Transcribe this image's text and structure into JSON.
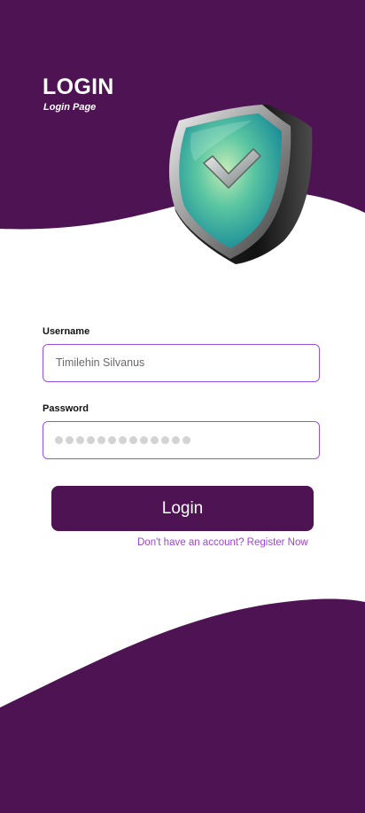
{
  "header": {
    "title": "LOGIN",
    "subtitle": "Login Page"
  },
  "form": {
    "username_label": "Username",
    "username_value": "Timilehin Silvanus",
    "password_label": "Password",
    "password_mask_count": 13,
    "login_label": "Login",
    "register_text": "Don't have an account? Register Now"
  },
  "illustration": {
    "icon": "shield-check-icon"
  },
  "colors": {
    "brand_purple": "#4e1353",
    "input_border": "#9d4fe0",
    "link": "#a044d8"
  }
}
